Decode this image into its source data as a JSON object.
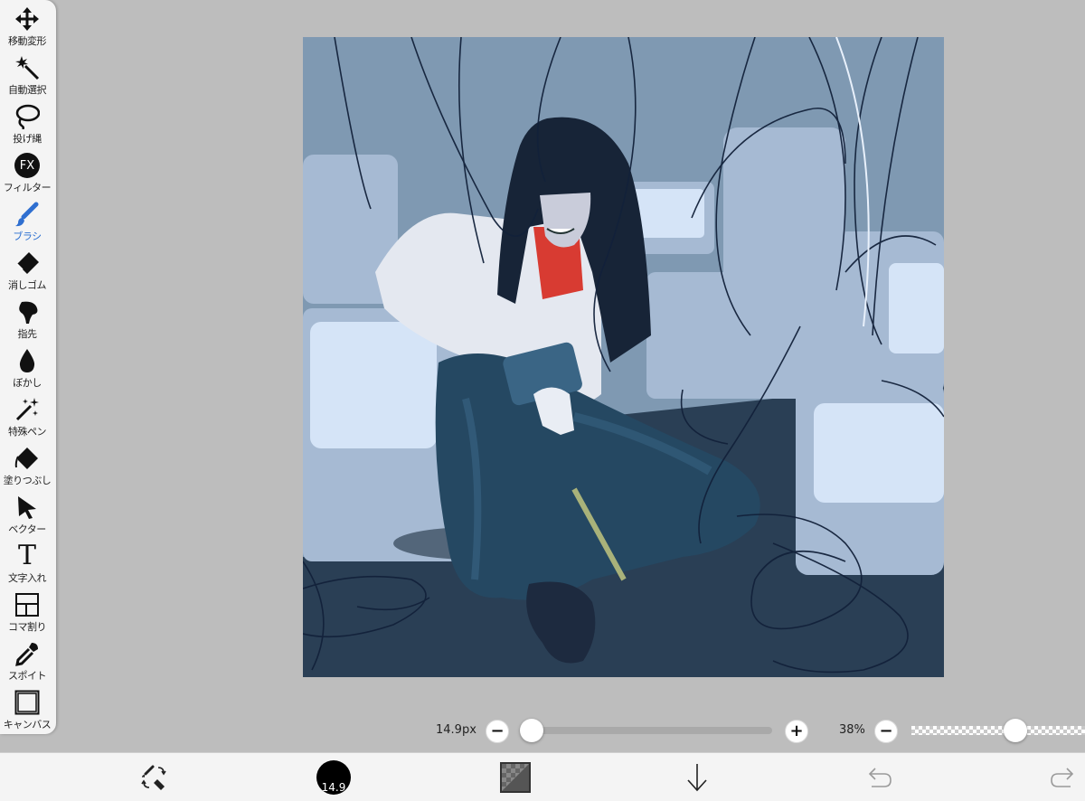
{
  "toolbar": {
    "items": [
      {
        "label": "移動変形",
        "icon": "move-arrows-icon"
      },
      {
        "label": "自動選択",
        "icon": "magic-wand-icon"
      },
      {
        "label": "投げ縄",
        "icon": "lasso-icon"
      },
      {
        "label": "フィルター",
        "icon": "fx-filter-icon",
        "icon_text": "FX"
      },
      {
        "label": "ブラシ",
        "icon": "brush-icon",
        "active": true
      },
      {
        "label": "消しゴム",
        "icon": "eraser-icon"
      },
      {
        "label": "指先",
        "icon": "finger-smudge-icon"
      },
      {
        "label": "ぼかし",
        "icon": "blur-drop-icon"
      },
      {
        "label": "特殊ペン",
        "icon": "special-pen-icon"
      },
      {
        "label": "塗りつぶし",
        "icon": "fill-bucket-icon"
      },
      {
        "label": "ベクター",
        "icon": "vector-cursor-icon"
      },
      {
        "label": "文字入れ",
        "icon": "text-icon",
        "icon_text": "T"
      },
      {
        "label": "コマ割り",
        "icon": "panel-layout-icon"
      },
      {
        "label": "スポイト",
        "icon": "eyedropper-icon"
      },
      {
        "label": "キャンバス",
        "icon": "canvas-icon"
      }
    ]
  },
  "brush_slider": {
    "value_label": "14.9px",
    "minus": "−",
    "plus": "+",
    "level": 0.04
  },
  "opacity_slider": {
    "value_label": "38%",
    "minus": "−",
    "level": 0.6
  },
  "bottom_bar": {
    "brush_size_text": "14.9",
    "items": [
      {
        "icon": "brush-eraser-toggle-icon"
      },
      {
        "icon": "brush-size-indicator"
      },
      {
        "icon": "color-swatch-icon"
      },
      {
        "icon": "download-arrow-icon"
      },
      {
        "icon": "undo-icon"
      },
      {
        "icon": "redo-icon"
      }
    ]
  },
  "colors": {
    "accent": "#2f6fd0",
    "toolbar_bg": "#f4f4f4",
    "workspace_bg": "#bdbdbd"
  }
}
